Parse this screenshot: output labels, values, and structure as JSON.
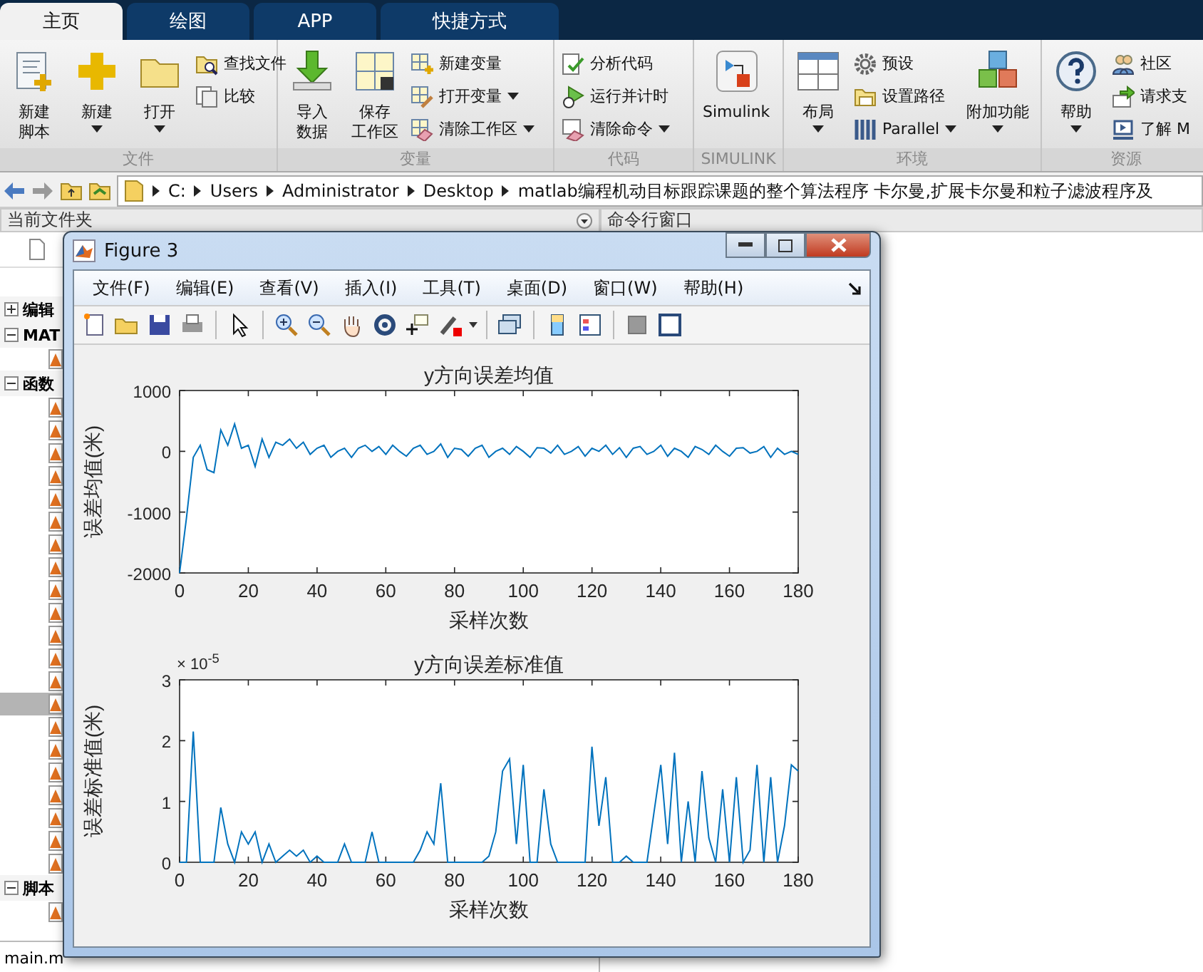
{
  "ribbon": {
    "tabs": [
      {
        "label": "主页",
        "selected": true
      },
      {
        "label": "绘图",
        "selected": false
      },
      {
        "label": "APP",
        "selected": false
      },
      {
        "label": "快捷方式",
        "selected": false
      }
    ],
    "sections": [
      {
        "title": "文件",
        "items": [
          {
            "kind": "big",
            "lines": [
              "新建",
              "脚本"
            ],
            "dropdown": false
          },
          {
            "kind": "big",
            "lines": [
              "新建"
            ],
            "dropdown": true
          },
          {
            "kind": "big",
            "lines": [
              "打开"
            ],
            "dropdown": true
          },
          {
            "kind": "stack",
            "items": [
              {
                "label": "查找文件",
                "dropdown": false
              },
              {
                "label": "比较",
                "dropdown": false
              }
            ]
          }
        ]
      },
      {
        "title": "变量",
        "items": [
          {
            "kind": "big",
            "lines": [
              "导入",
              "数据"
            ],
            "dropdown": false
          },
          {
            "kind": "big",
            "lines": [
              "保存",
              "工作区"
            ],
            "dropdown": false
          },
          {
            "kind": "stack",
            "items": [
              {
                "label": "新建变量",
                "dropdown": false
              },
              {
                "label": "打开变量",
                "dropdown": true
              },
              {
                "label": "清除工作区",
                "dropdown": true
              }
            ]
          }
        ]
      },
      {
        "title": "代码",
        "items": [
          {
            "kind": "stack",
            "items": [
              {
                "label": "分析代码",
                "dropdown": false
              },
              {
                "label": "运行并计时",
                "dropdown": false
              },
              {
                "label": "清除命令",
                "dropdown": true
              }
            ]
          }
        ]
      },
      {
        "title": "SIMULINK",
        "items": [
          {
            "kind": "big",
            "lines": [
              "Simulink"
            ],
            "dropdown": false
          }
        ]
      },
      {
        "title": "环境",
        "items": [
          {
            "kind": "big",
            "lines": [
              "布局"
            ],
            "dropdown": true
          },
          {
            "kind": "stack",
            "items": [
              {
                "label": "预设",
                "dropdown": false
              },
              {
                "label": "设置路径",
                "dropdown": false
              },
              {
                "label": "Parallel",
                "dropdown": true
              }
            ]
          },
          {
            "kind": "big",
            "lines": [
              "附加功能"
            ],
            "dropdown": true
          }
        ]
      },
      {
        "title": "资源",
        "items": [
          {
            "kind": "big",
            "lines": [
              "帮助"
            ],
            "dropdown": true
          },
          {
            "kind": "stack",
            "items": [
              {
                "label": "社区",
                "dropdown": false
              },
              {
                "label": "请求支",
                "dropdown": false
              },
              {
                "label": "了解 M",
                "dropdown": false
              }
            ]
          }
        ]
      }
    ]
  },
  "address_bar": {
    "path": [
      "C:",
      "Users",
      "Administrator",
      "Desktop",
      "matlab编程机动目标跟踪课题的整个算法程序 卡尔曼,扩展卡尔曼和粒子滤波程序及"
    ]
  },
  "current_folder": {
    "title": "当前文件夹",
    "tree": [
      {
        "label": "编辑",
        "expanded": false
      },
      {
        "label": "MAT",
        "expanded": true,
        "files": [
          {
            "selected": false
          }
        ]
      },
      {
        "label": "函数",
        "expanded": true,
        "files": [
          {
            "selected": false
          },
          {
            "selected": false
          },
          {
            "selected": false
          },
          {
            "selected": false
          },
          {
            "selected": false
          },
          {
            "selected": false
          },
          {
            "selected": false
          },
          {
            "selected": false
          },
          {
            "selected": false
          },
          {
            "selected": false
          },
          {
            "selected": false
          },
          {
            "selected": false
          },
          {
            "selected": false
          },
          {
            "selected": true
          },
          {
            "selected": false
          },
          {
            "selected": false
          },
          {
            "selected": false
          },
          {
            "selected": false
          },
          {
            "selected": false
          },
          {
            "selected": false
          },
          {
            "selected": false
          }
        ]
      },
      {
        "label": "脚本",
        "expanded": true,
        "files": [
          {
            "selected": false
          }
        ]
      }
    ],
    "status": "main.m"
  },
  "command_window": {
    "title": "命令行窗口"
  },
  "figure": {
    "title": "Figure 3",
    "menus": [
      "文件(F)",
      "编辑(E)",
      "查看(V)",
      "插入(I)",
      "工具(T)",
      "桌面(D)",
      "窗口(W)",
      "帮助(H)"
    ],
    "axes": [
      {
        "chart_data": {
          "type": "line",
          "title": "y方向误差均值",
          "xlabel": "采样次数",
          "ylabel": "误差均值(米)",
          "x": [
            0,
            2,
            4,
            6,
            8,
            10,
            12,
            14,
            16,
            18,
            20,
            22,
            24,
            26,
            28,
            30,
            32,
            34,
            36,
            38,
            40,
            42,
            44,
            46,
            48,
            50,
            52,
            54,
            56,
            58,
            60,
            62,
            64,
            66,
            68,
            70,
            72,
            74,
            76,
            78,
            80,
            82,
            84,
            86,
            88,
            90,
            92,
            94,
            96,
            98,
            100,
            102,
            104,
            106,
            108,
            110,
            112,
            114,
            116,
            118,
            120,
            122,
            124,
            126,
            128,
            130,
            132,
            134,
            136,
            138,
            140,
            142,
            144,
            146,
            148,
            150,
            152,
            154,
            156,
            158,
            160,
            162,
            164,
            166,
            168,
            170,
            172,
            174,
            176,
            178,
            180
          ],
          "series": [
            {
              "color": "#0072bd",
              "values": [
                -2000,
                -1100,
                -100,
                100,
                -300,
                -350,
                350,
                100,
                450,
                50,
                100,
                -250,
                200,
                -100,
                150,
                100,
                200,
                50,
                150,
                -50,
                50,
                100,
                -100,
                0,
                50,
                -100,
                50,
                100,
                0,
                80,
                -50,
                100,
                0,
                -80,
                50,
                100,
                -50,
                0,
                120,
                -100,
                50,
                30,
                -80,
                50,
                100,
                -100,
                0,
                50,
                -50,
                80,
                0,
                -100,
                60,
                50,
                -30,
                100,
                -50,
                0,
                80,
                -80,
                50,
                0,
                100,
                -50,
                60,
                -100,
                50,
                80,
                -50,
                0,
                100,
                -80,
                50,
                0,
                -100,
                80,
                30,
                -50,
                100,
                0,
                -80,
                50,
                60,
                -30,
                0,
                80,
                -100,
                50,
                -50,
                0,
                -50
              ]
            }
          ],
          "xlim": [
            0,
            180
          ],
          "ylim": [
            -2000,
            1000
          ],
          "xticks": [
            0,
            20,
            40,
            60,
            80,
            100,
            120,
            140,
            160,
            180
          ],
          "yticks": [
            -2000,
            -1000,
            0,
            1000
          ]
        }
      },
      {
        "exponent_label": "× 10$^{-5}$",
        "chart_data": {
          "type": "line",
          "title": "y方向误差标准值",
          "xlabel": "采样次数",
          "ylabel": "误差标准值(米)",
          "x": [
            0,
            2,
            4,
            6,
            8,
            10,
            12,
            14,
            16,
            18,
            20,
            22,
            24,
            26,
            28,
            30,
            32,
            34,
            36,
            38,
            40,
            42,
            44,
            46,
            48,
            50,
            52,
            54,
            56,
            58,
            60,
            62,
            64,
            66,
            68,
            70,
            72,
            74,
            76,
            78,
            80,
            82,
            84,
            86,
            88,
            90,
            92,
            94,
            96,
            98,
            100,
            102,
            104,
            106,
            108,
            110,
            112,
            114,
            116,
            118,
            120,
            122,
            124,
            126,
            128,
            130,
            132,
            134,
            136,
            138,
            140,
            142,
            144,
            146,
            148,
            150,
            152,
            154,
            156,
            158,
            160,
            162,
            164,
            166,
            168,
            170,
            172,
            174,
            176,
            178,
            180
          ],
          "series": [
            {
              "color": "#0072bd",
              "values": [
                0,
                0,
                2.15,
                0,
                0,
                0,
                0.9,
                0.3,
                0,
                0.5,
                0.3,
                0.5,
                0,
                0.3,
                0,
                0.1,
                0.2,
                0.1,
                0.2,
                0,
                0.1,
                0,
                0,
                0,
                0.3,
                0,
                0,
                0,
                0.5,
                0,
                0,
                0,
                0,
                0,
                0,
                0.2,
                0.5,
                0.3,
                1.3,
                0,
                0,
                0,
                0,
                0,
                0,
                0.1,
                0.5,
                1.5,
                1.7,
                0.3,
                1.6,
                0,
                0,
                1.2,
                0.3,
                0,
                0,
                0,
                0,
                0,
                1.9,
                0.6,
                1.4,
                0,
                0,
                0.1,
                0,
                0,
                0,
                0.8,
                1.6,
                0.3,
                1.8,
                0,
                1.0,
                0,
                1.5,
                0.4,
                0,
                1.2,
                0,
                1.4,
                0,
                0.2,
                1.6,
                0,
                1.4,
                0,
                0.6,
                1.6,
                1.5
              ]
            }
          ],
          "xlim": [
            0,
            180
          ],
          "ylim": [
            0,
            3
          ],
          "xticks": [
            0,
            20,
            40,
            60,
            80,
            100,
            120,
            140,
            160,
            180
          ],
          "yticks": [
            0,
            1,
            2,
            3
          ]
        }
      }
    ]
  }
}
